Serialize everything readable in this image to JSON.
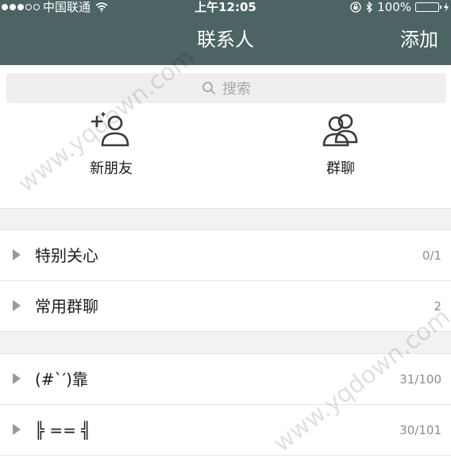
{
  "status_bar": {
    "carrier": "中国联通",
    "time": "上午12:05",
    "battery": "100%",
    "battery_level": 1.0,
    "icons": [
      "signal-dots-icon",
      "wifi-icon",
      "orientation-lock-icon",
      "bluetooth-icon",
      "battery-icon",
      "charging-icon"
    ]
  },
  "header": {
    "title": "联系人",
    "add_label": "添加",
    "background": "#4d6464"
  },
  "search": {
    "placeholder": "搜索"
  },
  "shortcuts": [
    {
      "label": "新朋友",
      "icon": "add-friend-icon"
    },
    {
      "label": "群聊",
      "icon": "group-chat-icon"
    }
  ],
  "groups": [
    {
      "name": "特别关心",
      "count": "0/1"
    },
    {
      "name": "常用群聊",
      "count": "2"
    },
    {
      "name": "(#`′)靠",
      "count": "31/100"
    },
    {
      "name": "╠ == ╣",
      "count": "30/101"
    }
  ],
  "watermark": "www.yqdown.com"
}
